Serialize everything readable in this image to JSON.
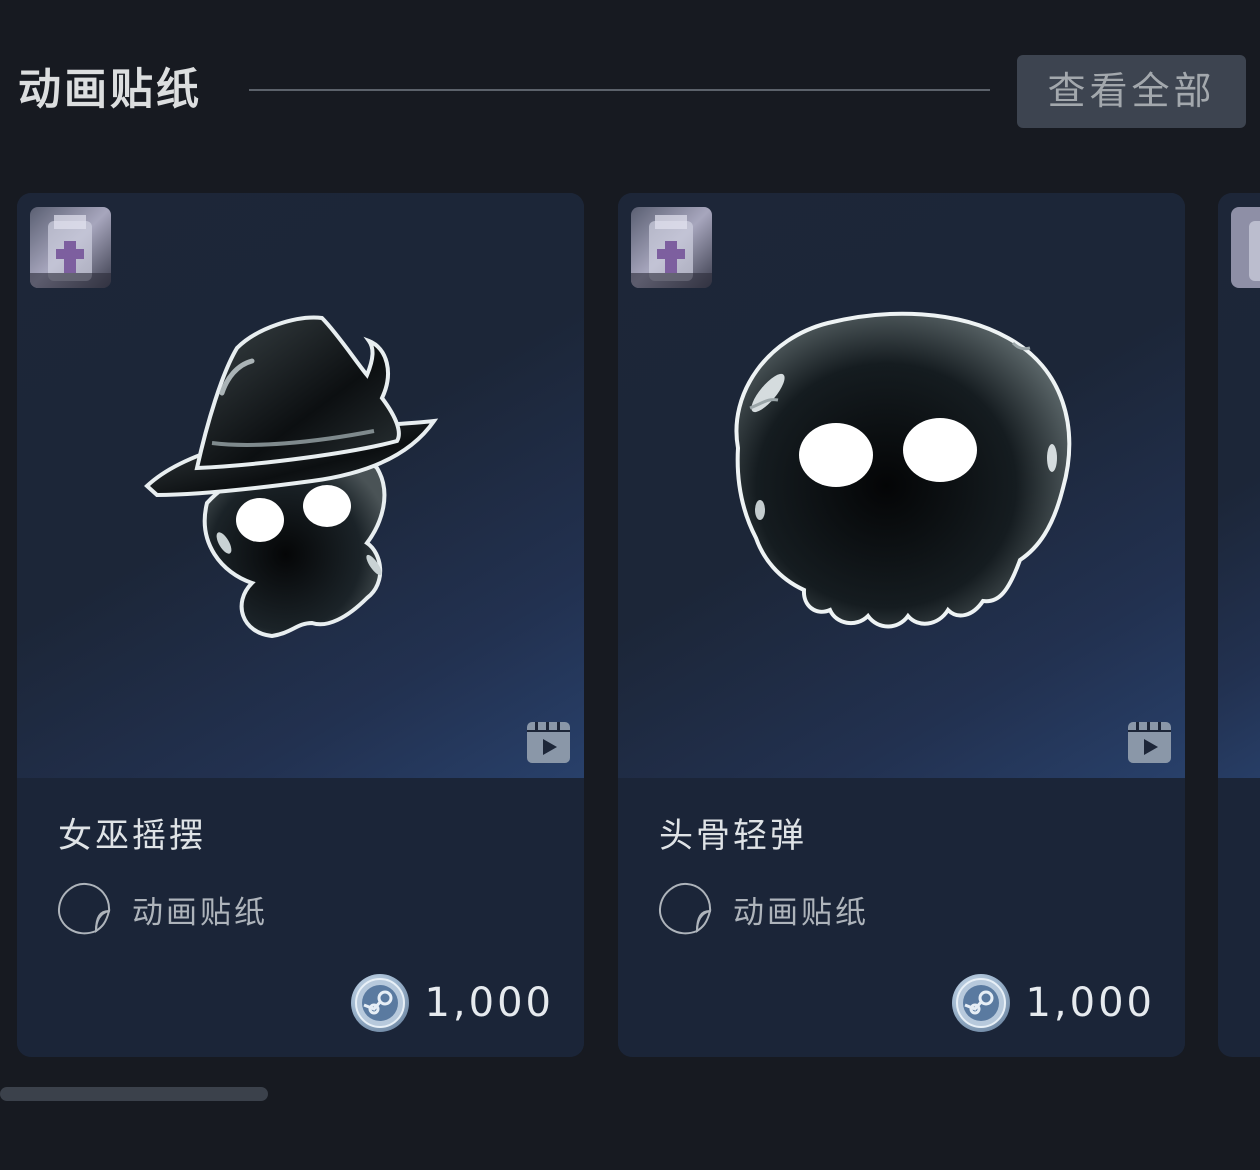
{
  "section": {
    "title": "动画贴纸",
    "view_all_label": "查看全部"
  },
  "cards": [
    {
      "title": "女巫摇摆",
      "type_label": "动画贴纸",
      "price": "1,000",
      "art_icon": "witch-ghost-sticker",
      "animated": true
    },
    {
      "title": "头骨轻弹",
      "type_label": "动画贴纸",
      "price": "1,000",
      "art_icon": "skull-sticker",
      "animated": true
    }
  ],
  "scroll": {
    "position": 0
  }
}
